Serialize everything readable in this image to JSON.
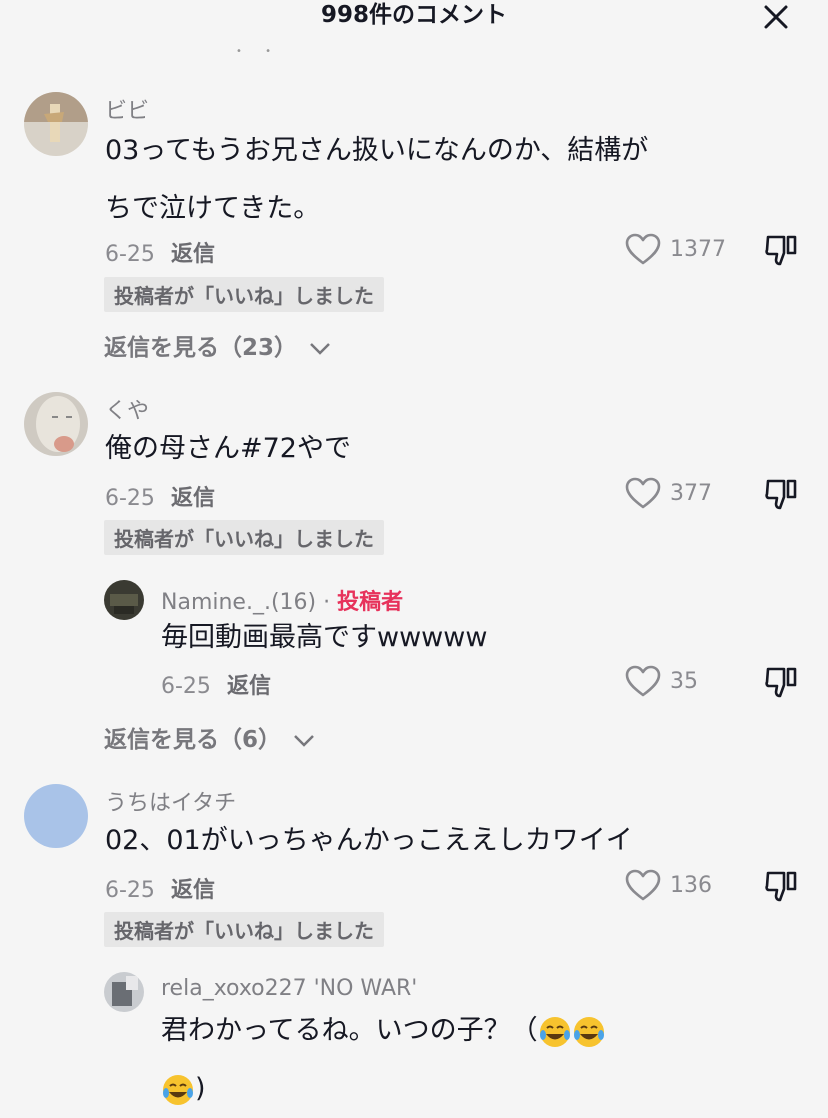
{
  "header": {
    "title": "998件のコメント"
  },
  "comments": [
    {
      "username": "ビビ",
      "text_line1": "03ってもうお兄さん扱いになんのか、結構が",
      "text_line2": "ちで泣けてきた。",
      "date": "6-25",
      "reply_label": "返信",
      "likes": "1377",
      "badge": "投稿者が「いいね」しました",
      "view_replies": "返信を見る（23）"
    },
    {
      "username": "くや",
      "text": "俺の母さん#72やで",
      "date": "6-25",
      "reply_label": "返信",
      "likes": "377",
      "badge": "投稿者が「いいね」しました",
      "reply": {
        "username": "Namine._.(16)",
        "separator": "·",
        "author_tag": "投稿者",
        "text": "毎回動画最高ですwwwww",
        "date": "6-25",
        "reply_label": "返信",
        "likes": "35"
      },
      "view_replies": "返信を見る（6）"
    },
    {
      "username": "うちはイタチ",
      "text": "02、01がいっちゃんかっこええしカワイイ",
      "date": "6-25",
      "reply_label": "返信",
      "likes": "136",
      "badge": "投稿者が「いいね」しました",
      "reply": {
        "username": "rela_xoxo227 'NO WAR'",
        "text_line1": "君わかってるね。いつの子？（",
        "text_line2": ")"
      }
    }
  ],
  "colors": {
    "author_tag": "#e7325b",
    "background": "#f5f5f5"
  }
}
